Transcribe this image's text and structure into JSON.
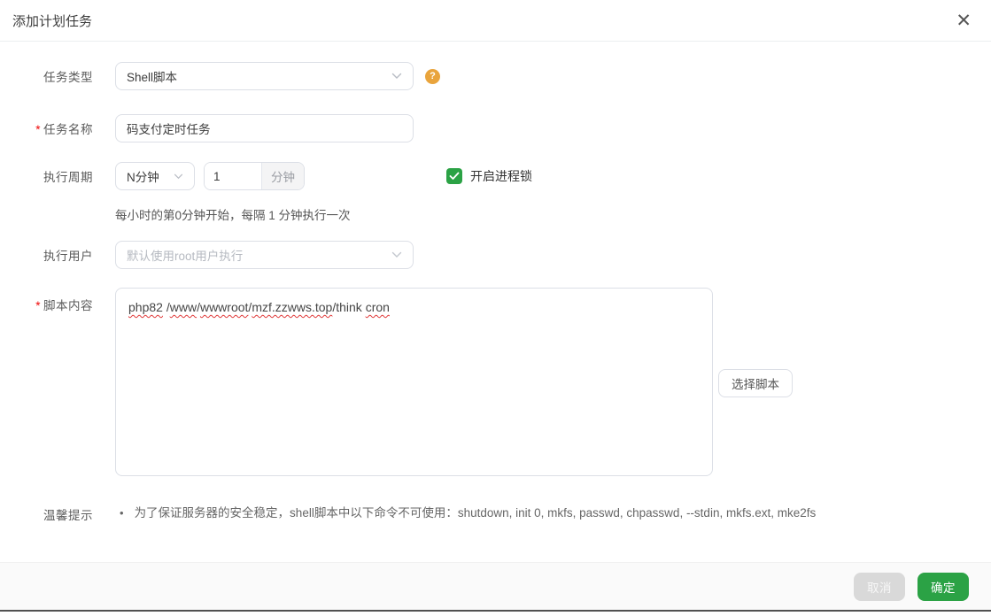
{
  "dialog": {
    "title": "添加计划任务",
    "close_glyph": "✕"
  },
  "form": {
    "task_type": {
      "label": "任务类型",
      "value": "Shell脚本",
      "help_glyph": "?"
    },
    "task_name": {
      "label": "任务名称",
      "required_mark": "*",
      "value": "码支付定时任务"
    },
    "cycle": {
      "label": "执行周期",
      "period_value": "N分钟",
      "interval_value": "1",
      "unit_suffix": "分钟",
      "process_lock_label": "开启进程锁",
      "process_lock_checked": true,
      "hint": "每小时的第0分钟开始，每隔 1 分钟执行一次"
    },
    "exec_user": {
      "label": "执行用户",
      "placeholder": "默认使用root用户执行"
    },
    "script": {
      "label": "脚本内容",
      "required_mark": "*",
      "value": "php82 /www/wwwroot/mzf.zzwws.top/think cron",
      "tokens": [
        {
          "text": "php82",
          "misspelled": true
        },
        {
          "text": " /",
          "misspelled": false
        },
        {
          "text": "www",
          "misspelled": true
        },
        {
          "text": "/",
          "misspelled": false
        },
        {
          "text": "wwwroot",
          "misspelled": true
        },
        {
          "text": "/",
          "misspelled": false
        },
        {
          "text": "mzf.zzwws.top",
          "misspelled": true
        },
        {
          "text": "/think ",
          "misspelled": false
        },
        {
          "text": "cron",
          "misspelled": true
        }
      ],
      "select_script_button": "选择脚本"
    },
    "tips": {
      "label": "温馨提示",
      "bullet": "•",
      "text": "为了保证服务器的安全稳定，shell脚本中以下命令不可使用：shutdown, init 0, mkfs, passwd, chpasswd, --stdin, mkfs.ext, mke2fs"
    }
  },
  "footer": {
    "cancel_label": "取消",
    "confirm_label": "确定"
  },
  "colors": {
    "primary_green": "#2ba245",
    "help_orange": "#e9a43c",
    "required_red": "#ef0808",
    "squiggle_red": "#e03a3a",
    "border_gray": "#dcdfe6",
    "footer_bg": "#fafafa"
  }
}
